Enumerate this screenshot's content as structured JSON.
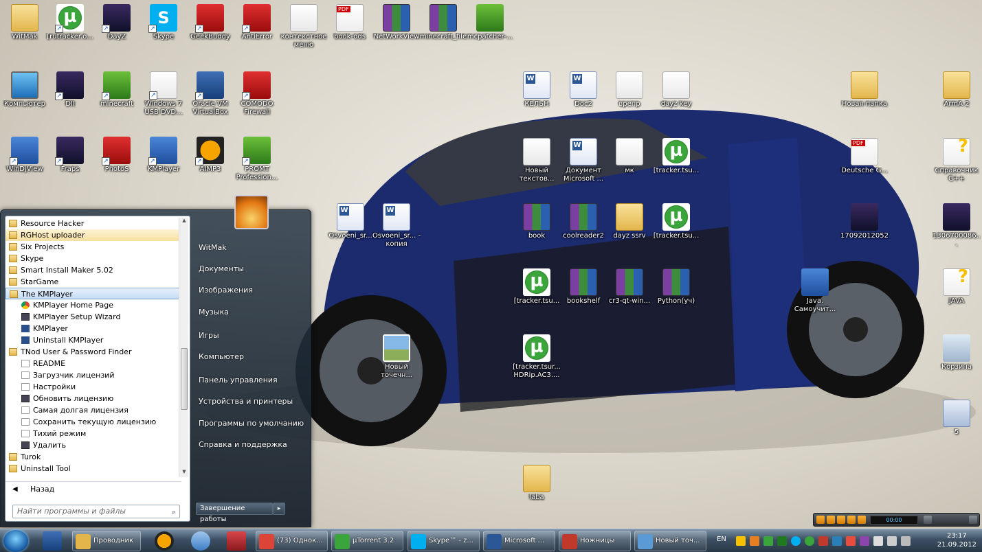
{
  "desktop": {
    "icons": [
      {
        "label": "WitMak",
        "icon": "user-folder-icon"
      },
      {
        "label": "[rutracker.o...",
        "icon": "utorrent-icon"
      },
      {
        "label": "DayZ",
        "icon": "dayz-icon"
      },
      {
        "label": "Skype",
        "icon": "skype-icon"
      },
      {
        "label": "GeekBuddy",
        "icon": "geekbuddy-icon"
      },
      {
        "label": "AntiError",
        "icon": "antierror-icon"
      },
      {
        "label": "контекстное меню",
        "icon": "context-menu-icon"
      },
      {
        "label": "book-ods",
        "icon": "pdf-document-icon"
      },
      {
        "label": "NetWorkView",
        "icon": "winrar-icon"
      },
      {
        "label": "minecraft_file",
        "icon": "winrar-icon"
      },
      {
        "label": "mcpatcher-...",
        "icon": "mcpatcher-icon"
      },
      {
        "label": "Компьютер",
        "icon": "computer-icon"
      },
      {
        "label": "DII",
        "icon": "diablo-icon"
      },
      {
        "label": "minecraft",
        "icon": "minecraft-icon"
      },
      {
        "label": "Windows 7 USB DVD...",
        "icon": "windows-usb-icon"
      },
      {
        "label": "Oracle VM VirtualBox",
        "icon": "virtualbox-icon"
      },
      {
        "label": "COMODO Firewall",
        "icon": "comodo-icon"
      },
      {
        "label": "WinDjView",
        "icon": "windjview-icon"
      },
      {
        "label": "Fraps",
        "icon": "fraps-icon"
      },
      {
        "label": "PhotoS",
        "icon": "photos-icon"
      },
      {
        "label": "KMPlayer",
        "icon": "kmplayer-icon"
      },
      {
        "label": "AIMP3",
        "icon": "aimp-icon"
      },
      {
        "label": "PROMT Profession...",
        "icon": "promt-icon"
      },
      {
        "label": "КЕЛЬН",
        "icon": "word-document-icon"
      },
      {
        "label": "Doc2",
        "icon": "word-document-icon"
      },
      {
        "label": "врепр",
        "icon": "text-document-icon"
      },
      {
        "label": "dayz key",
        "icon": "text-document-icon"
      },
      {
        "label": "Новый текстов...",
        "icon": "text-document-icon"
      },
      {
        "label": "Документ Microsoft ...",
        "icon": "word-document-icon"
      },
      {
        "label": "мк",
        "icon": "text-document-icon"
      },
      {
        "label": "[tracker.tsu...",
        "icon": "utorrent-icon"
      },
      {
        "label": "Osvoeni_sr...",
        "icon": "word-document-icon"
      },
      {
        "label": "Osvoeni_sr... - копия",
        "icon": "word-document-icon"
      },
      {
        "label": "book",
        "icon": "winrar-icon"
      },
      {
        "label": "coolreader2",
        "icon": "winrar-icon"
      },
      {
        "label": "dayz ssrv",
        "icon": "folder-icon"
      },
      {
        "label": "[tracker.tsu...",
        "icon": "utorrent-icon"
      },
      {
        "label": "[tracker.tsu...",
        "icon": "utorrent-icon"
      },
      {
        "label": "bookshelf",
        "icon": "winrar-icon"
      },
      {
        "label": "cr3-qt-win...",
        "icon": "winrar-icon"
      },
      {
        "label": "Python(уч)",
        "icon": "winrar-icon"
      },
      {
        "label": "Новый точечн...",
        "icon": "bitmap-icon"
      },
      {
        "label": "[tracker.tsur... HDRip.AC3....",
        "icon": "utorrent-icon"
      },
      {
        "label": "laba",
        "icon": "folder-icon"
      },
      {
        "label": "Новая папка",
        "icon": "folder-icon"
      },
      {
        "label": "ArmA 2",
        "icon": "folder-icon"
      },
      {
        "label": "Deutsche G...",
        "icon": "pdf-document-icon"
      },
      {
        "label": "Справочник С++",
        "icon": "help-file-icon"
      },
      {
        "label": "17092012052",
        "icon": "image-icon"
      },
      {
        "label": "1306700086...",
        "icon": "image-icon"
      },
      {
        "label": "Java. Самоучит...",
        "icon": "windjview-icon"
      },
      {
        "label": "JAVA",
        "icon": "help-file-icon"
      },
      {
        "label": "Корзина",
        "icon": "recycle-bin-icon"
      },
      {
        "label": "5",
        "icon": "settings-file-icon"
      }
    ]
  },
  "start_menu": {
    "programs": [
      {
        "label": "Resource Hacker",
        "type": "folder",
        "state": ""
      },
      {
        "label": "RGHost uploader",
        "type": "folder",
        "state": "highlight"
      },
      {
        "label": "Six Projects",
        "type": "folder",
        "state": ""
      },
      {
        "label": "Skype",
        "type": "folder",
        "state": ""
      },
      {
        "label": "Smart Install Maker 5.02",
        "type": "folder",
        "state": ""
      },
      {
        "label": "StarGame",
        "type": "folder",
        "state": ""
      },
      {
        "label": "The KMPlayer",
        "type": "folder",
        "state": "selected"
      },
      {
        "label": "KMPlayer Home Page",
        "type": "chrome",
        "state": "sub"
      },
      {
        "label": "KMPlayer Setup Wizard",
        "type": "app",
        "state": "sub"
      },
      {
        "label": "KMPlayer",
        "type": "kmp",
        "state": "sub"
      },
      {
        "label": "Uninstall KMPlayer",
        "type": "kmp",
        "state": "sub"
      },
      {
        "label": "TNod User & Password Finder",
        "type": "folder",
        "state": ""
      },
      {
        "label": "README",
        "type": "blank",
        "state": "sub"
      },
      {
        "label": "Загрузчик лицензий",
        "type": "blank",
        "state": "sub"
      },
      {
        "label": "Настройки",
        "type": "blank",
        "state": "sub"
      },
      {
        "label": "Обновить лицензию",
        "type": "app",
        "state": "sub"
      },
      {
        "label": "Самая долгая лицензия",
        "type": "blank",
        "state": "sub"
      },
      {
        "label": "Сохранить текущую лицензию",
        "type": "blank",
        "state": "sub"
      },
      {
        "label": "Тихий режим",
        "type": "blank",
        "state": "sub"
      },
      {
        "label": "Удалить",
        "type": "app",
        "state": "sub"
      },
      {
        "label": "Turok",
        "type": "folder",
        "state": ""
      },
      {
        "label": "Uninstall Tool",
        "type": "folder",
        "state": ""
      }
    ],
    "back_label": "Назад",
    "search_placeholder": "Найти программы и файлы",
    "right_items": [
      {
        "label": "WitMak"
      },
      {
        "label": "Документы"
      },
      {
        "label": "Изображения"
      },
      {
        "label": "Музыка"
      },
      {
        "label": "Игры"
      },
      {
        "label": "Компьютер"
      },
      {
        "label": "Панель управления"
      },
      {
        "label": "Устройства и принтеры"
      },
      {
        "label": "Программы по умолчанию"
      },
      {
        "label": "Справка и поддержка"
      }
    ],
    "shutdown_label": "Завершение работы"
  },
  "taskbar": {
    "buttons": [
      {
        "label": "Проводник",
        "icon": "explorer-icon",
        "color": "#e3b64c"
      },
      {
        "label": "(73) Однок...",
        "icon": "chrome-icon",
        "color": "#db4437"
      },
      {
        "label": "µTorrent 3.2",
        "icon": "utorrent-icon",
        "color": "#3aa53a"
      },
      {
        "label": "Skype™ - z...",
        "icon": "skype-icon",
        "color": "#00aff0"
      },
      {
        "label": "Microsoft ...",
        "icon": "word-icon",
        "color": "#2b5797"
      },
      {
        "label": "Ножницы",
        "icon": "scissors-icon",
        "color": "#c0392b"
      },
      {
        "label": "Новый точ...",
        "icon": "paint-icon",
        "color": "#5b9bd5"
      }
    ],
    "language": "EN",
    "time": "23:17",
    "date": "21.09.2012",
    "aimp_time": "00:00"
  }
}
